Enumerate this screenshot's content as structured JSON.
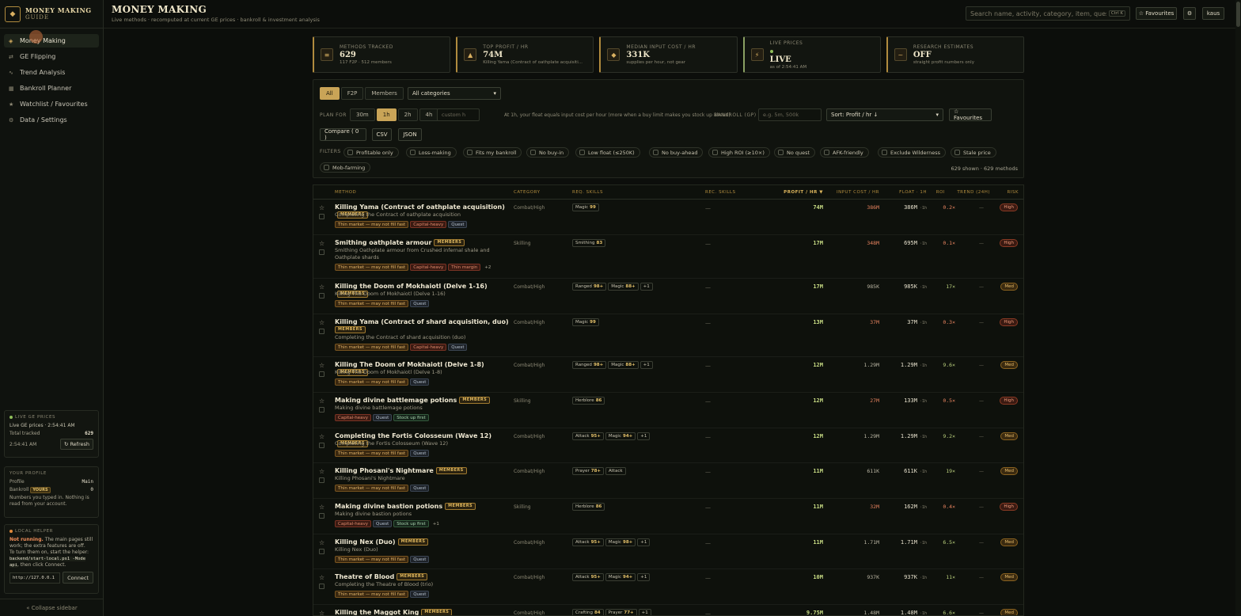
{
  "app": {
    "title_line1": "MONEY MAKING",
    "title_line2": "GUIDE",
    "logo": "◆"
  },
  "sidebar": {
    "items": [
      {
        "label": "Money Making",
        "icon": "◈"
      },
      {
        "label": "GE Flipping",
        "icon": "⇄"
      },
      {
        "label": "Trend Analysis",
        "icon": "∿"
      },
      {
        "label": "Bankroll Planner",
        "icon": "▦"
      },
      {
        "label": "Watchlist / Favourites",
        "icon": "★"
      },
      {
        "label": "Data / Settings",
        "icon": "⚙"
      }
    ],
    "live": {
      "header": "LIVE GE PRICES",
      "status": "Live GE prices · 2:54:41 AM",
      "total_label": "Total tracked",
      "total_value": "629",
      "time": "2:54:41 AM",
      "refresh": "↻ Refresh"
    },
    "profile": {
      "header": "YOUR PROFILE",
      "profile_label": "Profile",
      "profile_value": "Main",
      "bankroll_label": "Bankroll",
      "bankroll_badge": "YOURS",
      "bankroll_value": "0",
      "note": "Numbers you typed in. Nothing is read from your account."
    },
    "helper": {
      "header": "LOCAL HELPER",
      "status": "Not running.",
      "msg1": " The main pages still work; the extra features are off.",
      "msg2": "To turn them on, start the helper:",
      "cmd": "backend/start-local.ps1 -Mode api",
      "msg3": ", then click Connect.",
      "url": "http://127.0.0.1",
      "connect": "Connect"
    },
    "collapse": "« Collapse sidebar"
  },
  "header": {
    "title": "MONEY MAKING",
    "subtitle": "Live methods · recomputed at current GE prices · bankroll & investment analysis"
  },
  "search": {
    "placeholder": "Search name, activity, category, item, quest, s",
    "kbd": "Ctrl K"
  },
  "topbar": {
    "favourites": "☆ Favourites",
    "settings": "⚙",
    "user": "kaus"
  },
  "stats": [
    {
      "icon": "≡",
      "label": "METHODS TRACKED",
      "value": "629",
      "sub": "117 F2P · 512 members"
    },
    {
      "icon": "▲",
      "label": "TOP PROFIT / HR",
      "value": "74M",
      "sub": "Killing Yama (Contract of oathplate acquisiti..."
    },
    {
      "icon": "◆",
      "label": "MEDIAN INPUT COST / HR",
      "value": "331K",
      "sub": "supplies per hour, not gear"
    },
    {
      "icon": "⚡",
      "label": "LIVE PRICES",
      "value": "LIVE",
      "sub": "as of 2:54:41 AM"
    },
    {
      "icon": "~",
      "label": "RESEARCH ESTIMATES",
      "value": "OFF",
      "sub": "straight profit numbers only"
    }
  ],
  "controls": {
    "membership": [
      "All",
      "F2P",
      "Members"
    ],
    "category": "All categories",
    "plan_label": "PLAN FOR",
    "durations": [
      "30m",
      "1h",
      "2h",
      "4h"
    ],
    "custom_placeholder": "custom h",
    "hint": "At 1h, your float equals input cost per hour (more when a buy limit makes you stock up ahead).",
    "bankroll_label": "BANKROLL (GP)",
    "bankroll_placeholder": "e.g. 5m, 500k",
    "sort": "Sort: Profit / hr ↓",
    "favourites": "☆ Favourites",
    "compare": "Compare ( 0 )",
    "csv": "CSV",
    "json": "JSON",
    "filters_label": "FILTERS",
    "filters": [
      "Profitable only",
      "Loss-making",
      "Fits my bankroll",
      "No buy-in",
      "Low float (≤250K)",
      "No buy-ahead",
      "High ROI (≥10×)",
      "No quest",
      "AFK-friendly",
      "Exclude Wilderness",
      "Stale price",
      "Mob-farming"
    ],
    "counts": "629 shown · 629 methods"
  },
  "table": {
    "headers": {
      "method": "METHOD",
      "category": "CATEGORY",
      "req": "REQ. SKILLS",
      "rec": "REC. SKILLS",
      "profit": "PROFIT / HR ▼",
      "cost": "INPUT COST / HR",
      "float": "FLOAT · 1H",
      "roi": "ROI",
      "trend": "TREND (24H)",
      "risk": "RISK"
    },
    "member_badge": "MEMBERS",
    "rows": [
      {
        "name": "Killing Yama (Contract of oathplate acquisition)",
        "desc": "Completing the Contract of oathplate acquisition",
        "category": "Combat/High",
        "skills": [
          [
            "Magic",
            "99"
          ]
        ],
        "more": "",
        "rec": "—",
        "profit": "74M",
        "cost": "386M",
        "costHi": true,
        "float": "386M",
        "roi": "0.2×",
        "roiLo": true,
        "trend": "—",
        "risk": "High",
        "tags": [
          [
            "warn",
            "Thin market — may not fill fast"
          ],
          [
            "cap",
            "Capital-heavy"
          ],
          [
            "q",
            "Quest"
          ]
        ],
        "h": 45,
        "descLines": 1
      },
      {
        "name": "Smithing oathplate armour",
        "desc": "Smithing Oathplate armour from Crushed infernal shale and Oathplate shards",
        "category": "Skilling",
        "skills": [
          [
            "Smithing",
            "83"
          ]
        ],
        "more": "",
        "rec": "—",
        "profit": "17M",
        "cost": "348M",
        "costHi": true,
        "float": "695M",
        "roi": "0.1×",
        "roiLo": true,
        "trend": "—",
        "risk": "High",
        "tags": [
          [
            "warn",
            "Thin market — may not fill fast"
          ],
          [
            "cap",
            "Capital-heavy"
          ],
          [
            "cap",
            "Thin margin"
          ],
          [
            "more",
            "+2"
          ]
        ],
        "h": 55,
        "descLines": 2
      },
      {
        "name": "Killing the Doom of Mokhaiotl (Delve 1-16)",
        "desc": "Killing The Doom of Mokhaiotl (Delve 1-16)",
        "category": "Combat/High",
        "skills": [
          [
            "Ranged",
            "98+"
          ],
          [
            "Magic",
            "88+"
          ]
        ],
        "more": "+1",
        "rec": "—",
        "profit": "17M",
        "cost": "985K",
        "costHi": false,
        "float": "985K",
        "roi": "17×",
        "roiLo": false,
        "trend": "—",
        "risk": "Med",
        "tags": [
          [
            "warn",
            "Thin market — may not fill fast"
          ],
          [
            "q",
            "Quest"
          ]
        ],
        "h": 45,
        "descLines": 1
      },
      {
        "name": "Killing Yama (Contract of shard acquisition, duo)",
        "desc": "Completing the Contract of shard acquisition (duo)",
        "category": "Combat/High",
        "skills": [
          [
            "Magic",
            "99"
          ]
        ],
        "more": "",
        "rec": "—",
        "profit": "13M",
        "cost": "37M",
        "costHi": true,
        "float": "37M",
        "roi": "0.3×",
        "roiLo": true,
        "trend": "—",
        "risk": "High",
        "tags": [
          [
            "warn",
            "Thin market — may not fill fast"
          ],
          [
            "cap",
            "Capital-heavy"
          ],
          [
            "q",
            "Quest"
          ]
        ],
        "h": 54,
        "descLines": 1,
        "badgeNewLine": true
      },
      {
        "name": "Killing The Doom of Mokhaiotl (Delve 1-8)",
        "desc": "Killing The Doom of Mokhaiotl (Delve 1-8)",
        "category": "Combat/High",
        "skills": [
          [
            "Ranged",
            "98+"
          ],
          [
            "Magic",
            "88+"
          ]
        ],
        "more": "+1",
        "rec": "—",
        "profit": "12M",
        "cost": "1.29M",
        "costHi": false,
        "float": "1.29M",
        "roi": "9.6×",
        "roiLo": false,
        "trend": "—",
        "risk": "Med",
        "tags": [
          [
            "warn",
            "Thin market — may not fill fast"
          ],
          [
            "q",
            "Quest"
          ]
        ],
        "h": 45,
        "descLines": 1
      },
      {
        "name": "Making divine battlemage potions",
        "desc": "Making divine battlemage potions",
        "category": "Skilling",
        "skills": [
          [
            "Herblore",
            "86"
          ]
        ],
        "more": "",
        "rec": "—",
        "profit": "12M",
        "cost": "27M",
        "costHi": true,
        "float": "133M",
        "roi": "0.5×",
        "roiLo": true,
        "trend": "—",
        "risk": "High",
        "tags": [
          [
            "cap",
            "Capital-heavy"
          ],
          [
            "q",
            "Quest"
          ],
          [
            "stock",
            "Stock up first"
          ]
        ],
        "h": 45,
        "descLines": 1
      },
      {
        "name": "Completing the Fortis Colosseum (Wave 12)",
        "desc": "Completing the Fortis Colosseum (Wave 12)",
        "category": "Combat/High",
        "skills": [
          [
            "Attack",
            "95+"
          ],
          [
            "Magic",
            "94+"
          ]
        ],
        "more": "+1",
        "rec": "—",
        "profit": "12M",
        "cost": "1.29M",
        "costHi": false,
        "float": "1.29M",
        "roi": "9.2×",
        "roiLo": false,
        "trend": "—",
        "risk": "Med",
        "tags": [
          [
            "warn",
            "Thin market — may not fill fast"
          ],
          [
            "q",
            "Quest"
          ]
        ],
        "h": 44,
        "descLines": 1
      },
      {
        "name": "Killing Phosani's Nightmare",
        "desc": "Killing Phosani's Nightmare",
        "category": "Combat/High",
        "skills": [
          [
            "Prayer",
            "78+"
          ],
          [
            "Attack",
            ""
          ]
        ],
        "more": "",
        "rec": "—",
        "profit": "11M",
        "cost": "611K",
        "costHi": false,
        "float": "611K",
        "roi": "19×",
        "roiLo": false,
        "trend": "—",
        "risk": "Med",
        "tags": [
          [
            "warn",
            "Thin market — may not fill fast"
          ],
          [
            "q",
            "Quest"
          ]
        ],
        "h": 45,
        "descLines": 1
      },
      {
        "name": "Making divine bastion potions",
        "desc": "Making divine bastion potions",
        "category": "Skilling",
        "skills": [
          [
            "Herblore",
            "86"
          ]
        ],
        "more": "",
        "rec": "—",
        "profit": "11M",
        "cost": "32M",
        "costHi": true,
        "float": "162M",
        "roi": "0.4×",
        "roiLo": true,
        "trend": "—",
        "risk": "High",
        "tags": [
          [
            "cap",
            "Capital-heavy"
          ],
          [
            "q",
            "Quest"
          ],
          [
            "stock",
            "Stock up first"
          ],
          [
            "more",
            "+1"
          ]
        ],
        "h": 45,
        "descLines": 1
      },
      {
        "name": "Killing Nex (Duo)",
        "desc": "Killing Nex (Duo)",
        "category": "Combat/High",
        "skills": [
          [
            "Attack",
            "95+"
          ],
          [
            "Magic",
            "98+"
          ]
        ],
        "more": "+1",
        "rec": "—",
        "profit": "11M",
        "cost": "1.71M",
        "costHi": false,
        "float": "1.71M",
        "roi": "6.5×",
        "roiLo": false,
        "trend": "—",
        "risk": "Med",
        "tags": [
          [
            "warn",
            "Thin market — may not fill fast"
          ],
          [
            "q",
            "Quest"
          ]
        ],
        "h": 44,
        "descLines": 1
      },
      {
        "name": "Theatre of Blood",
        "desc": "Completing the Theatre of Blood (trio)",
        "category": "Combat/High",
        "skills": [
          [
            "Attack",
            "95+"
          ],
          [
            "Magic",
            "94+"
          ]
        ],
        "more": "+1",
        "rec": "—",
        "profit": "10M",
        "cost": "937K",
        "costHi": false,
        "float": "937K",
        "roi": "11×",
        "roiLo": false,
        "trend": "—",
        "risk": "Med",
        "tags": [
          [
            "warn",
            "Thin market — may not fill fast"
          ],
          [
            "q",
            "Quest"
          ]
        ],
        "h": 45,
        "descLines": 1
      },
      {
        "name": "Killing the Maggot King",
        "desc": "",
        "category": "Combat/High",
        "skills": [
          [
            "Crafting",
            "84"
          ],
          [
            "Prayer",
            "77+"
          ]
        ],
        "more": "+1",
        "rec": "—",
        "profit": "9.75M",
        "cost": "1.48M",
        "costHi": false,
        "float": "1.48M",
        "roi": "6.6×",
        "roiLo": false,
        "trend": "—",
        "risk": "Med",
        "tags": [],
        "h": 40,
        "descLines": 0
      }
    ]
  }
}
